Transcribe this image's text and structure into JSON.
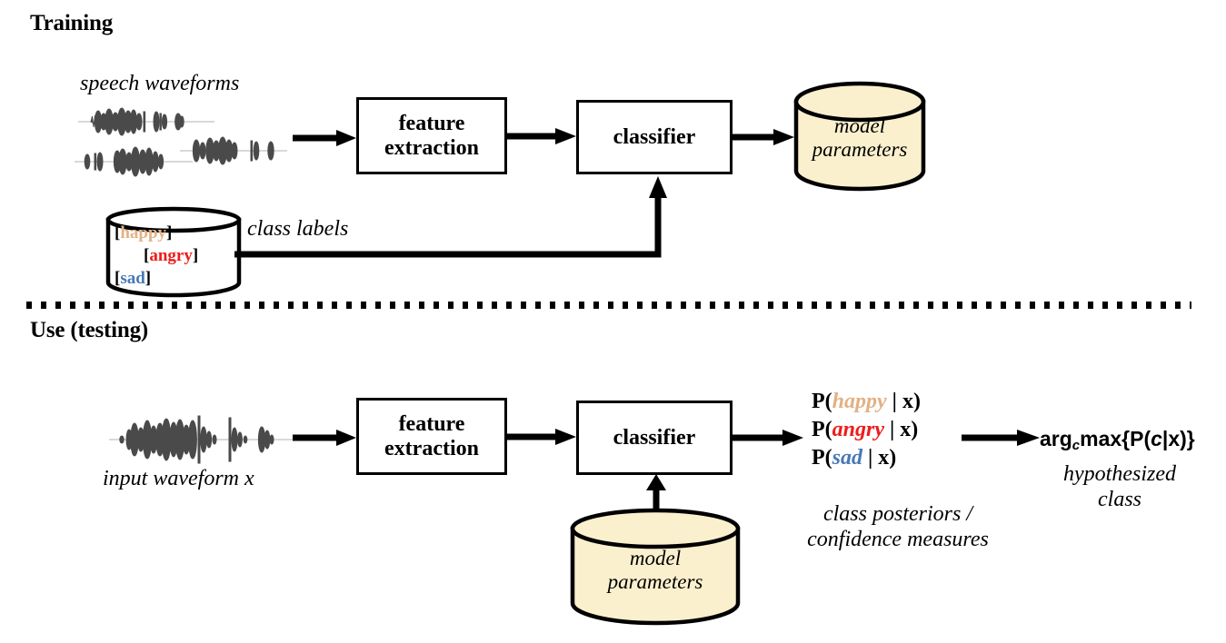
{
  "diagram": {
    "title_training": "Training",
    "title_testing": "Use (testing)",
    "colors": {
      "happy": "#E3B184",
      "angry": "#EE1C1C",
      "sad": "#4878B8",
      "cylinder_fill": "#FAF0CD",
      "stroke": "#000000",
      "background": "#FFFFFF"
    }
  },
  "training": {
    "speech_waveforms_label": "speech waveforms",
    "feature_extraction_line1": "feature",
    "feature_extraction_line2": "extraction",
    "classifier_label": "classifier",
    "model_parameters_line1": "model",
    "model_parameters_line2": "parameters",
    "class_labels_label": "class labels",
    "class_labels": [
      {
        "open": "[",
        "name": "happy",
        "close": "]"
      },
      {
        "open": "[",
        "name": "angry",
        "close": "]"
      },
      {
        "open": "[",
        "name": "sad",
        "close": "]"
      }
    ]
  },
  "testing": {
    "input_waveform_label": "input waveform x",
    "feature_extraction_line1": "feature",
    "feature_extraction_line2": "extraction",
    "classifier_label": "classifier",
    "model_parameters_line1": "model",
    "model_parameters_line2": "parameters",
    "posteriors": [
      {
        "prefix": "P(",
        "klass": "happy",
        "suffix": " | x)"
      },
      {
        "prefix": "P(",
        "klass": "angry",
        "suffix": " | x)"
      },
      {
        "prefix": "P(",
        "klass": "sad",
        "suffix": " | x)"
      }
    ],
    "posterior_caption_line1": "class posteriors /",
    "posterior_caption_line2": "confidence measures",
    "argmax_expr_pre": "arg",
    "argmax_expr_sub": "c",
    "argmax_expr_mid": "max{P(",
    "argmax_expr_var": "c",
    "argmax_expr_post": "|x)}",
    "hypothesized_line1": "hypothesized",
    "hypothesized_line2": "class"
  }
}
